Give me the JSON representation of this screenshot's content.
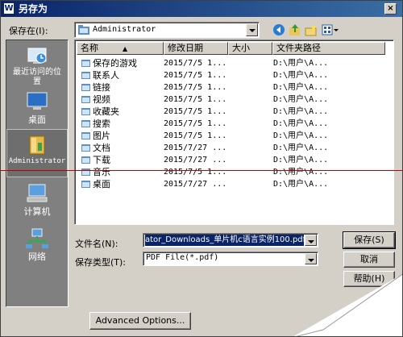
{
  "window": {
    "title": "另存为"
  },
  "toolbar": {
    "save_in_label": "保存在(I):",
    "location": "Administrator"
  },
  "places": [
    {
      "label": "最近访问的位置",
      "icon": "recent-places-icon"
    },
    {
      "label": "桌面",
      "icon": "desktop-icon"
    },
    {
      "label": "Administrator",
      "icon": "user-folder-icon"
    },
    {
      "label": "计算机",
      "icon": "computer-icon"
    },
    {
      "label": "网络",
      "icon": "network-icon"
    }
  ],
  "columns": {
    "name": "名称",
    "date": "修改日期",
    "size": "大小",
    "path": "文件夹路径"
  },
  "files": [
    {
      "name": "保存的游戏",
      "date": "2015/7/5 1...",
      "path": "D:\\用户\\A..."
    },
    {
      "name": "联系人",
      "date": "2015/7/5 1...",
      "path": "D:\\用户\\A..."
    },
    {
      "name": "链接",
      "date": "2015/7/5 1...",
      "path": "D:\\用户\\A..."
    },
    {
      "name": "视频",
      "date": "2015/7/5 1...",
      "path": "D:\\用户\\A..."
    },
    {
      "name": "收藏夹",
      "date": "2015/7/5 1...",
      "path": "D:\\用户\\A..."
    },
    {
      "name": "搜索",
      "date": "2015/7/5 1...",
      "path": "D:\\用户\\A..."
    },
    {
      "name": "图片",
      "date": "2015/7/5 1...",
      "path": "D:\\用户\\A..."
    },
    {
      "name": "文档",
      "date": "2015/7/27 ...",
      "path": "D:\\用户\\A..."
    },
    {
      "name": "下载",
      "date": "2015/7/27 ...",
      "path": "D:\\用户\\A..."
    },
    {
      "name": "音乐",
      "date": "2015/7/5 1...",
      "path": "D:\\用户\\A..."
    },
    {
      "name": "桌面",
      "date": "2015/7/27 ...",
      "path": "D:\\用户\\A..."
    }
  ],
  "form": {
    "filename_label": "文件名(N):",
    "filename_value": "ator_Downloads_单片机c语言实例100.pdf",
    "filetype_label": "保存类型(T):",
    "filetype_value": "PDF File(*.pdf)"
  },
  "buttons": {
    "save": "保存(S)",
    "cancel": "取消",
    "help": "帮助(H)",
    "advanced": "Advanced Options..."
  },
  "colors": {
    "titlebar": "#0a246a",
    "dialog_bg": "#d4d0c8",
    "places_bg": "#808080",
    "selection": "#0a246a"
  }
}
